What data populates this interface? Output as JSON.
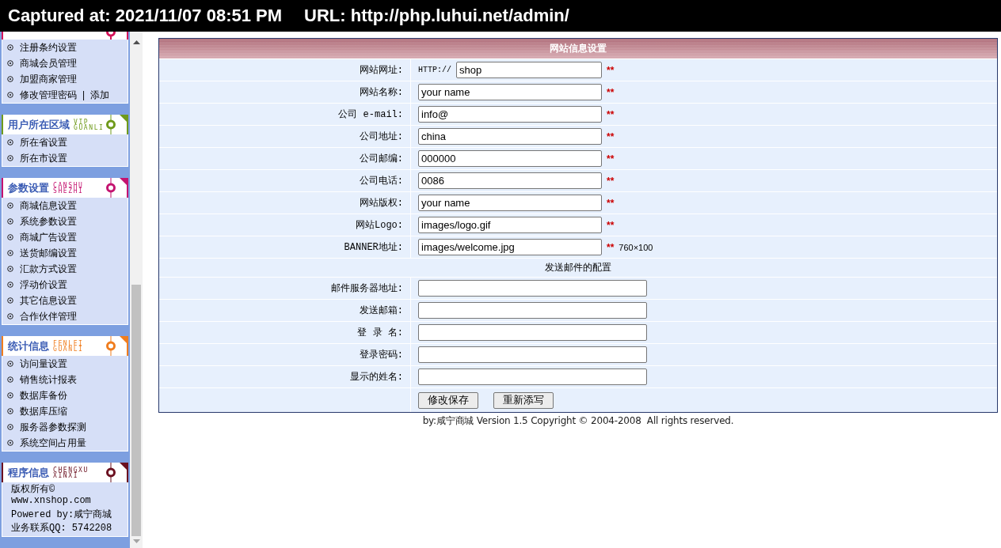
{
  "capture_banner": {
    "captured_at": "Captured at: 2021/11/07 08:51 PM",
    "url": "URL: http://php.luhui.net/admin/"
  },
  "sidebar": {
    "panels": [
      {
        "kind": "links",
        "color": "#d4145a",
        "items": [
          {
            "label": "注册条约设置"
          },
          {
            "label": "商城会员管理"
          },
          {
            "label": "加盟商家管理"
          },
          {
            "label": "修改管理密码",
            "separator": "|",
            "extra": "添加"
          }
        ]
      },
      {
        "kind": "links",
        "title": "用户所在区域",
        "subtitle": [
          "VIP",
          "GUANLI"
        ],
        "color": "#6f9a1b",
        "items": [
          {
            "label": "所在省设置"
          },
          {
            "label": "所在市设置"
          }
        ]
      },
      {
        "kind": "links",
        "title": "参数设置",
        "subtitle": [
          "CANSHU",
          "SHEZHI"
        ],
        "color": "#c41370",
        "items": [
          {
            "label": "商城信息设置"
          },
          {
            "label": "系统参数设置"
          },
          {
            "label": "商城广告设置"
          },
          {
            "label": "送货邮编设置"
          },
          {
            "label": "汇款方式设置"
          },
          {
            "label": "浮动价设置"
          },
          {
            "label": "其它信息设置"
          },
          {
            "label": "合作伙伴管理"
          }
        ]
      },
      {
        "kind": "links",
        "title": "统计信息",
        "subtitle": [
          "FENLEI",
          "GUANLI"
        ],
        "color": "#f07d1e",
        "items": [
          {
            "label": "访问量设置"
          },
          {
            "label": "销售统计报表"
          },
          {
            "label": "数据库备份"
          },
          {
            "label": "数据库压缩"
          },
          {
            "label": "服务器参数探测"
          },
          {
            "label": "系统空间占用量"
          }
        ]
      },
      {
        "kind": "info",
        "title": "程序信息",
        "subtitle": [
          "CHENGXU",
          "XINXI"
        ],
        "color": "#6b1020",
        "lines": [
          "版权所有©",
          "www.xnshop.com",
          "Powered by:咸宁商城",
          "业务联系QQ: 5742208"
        ]
      }
    ]
  },
  "form": {
    "title": "网站信息设置",
    "fields": [
      {
        "label": "网站网址:",
        "prefix": "HTTP://",
        "value": "shop",
        "mark": "**"
      },
      {
        "label": "网站名称:",
        "value": "your name",
        "mark": "**"
      },
      {
        "label": "公司 e-mail:",
        "value": "info@",
        "mark": "**"
      },
      {
        "label": "公司地址:",
        "value": "china",
        "mark": "**"
      },
      {
        "label": "公司邮编:",
        "value": "000000",
        "mark": "**"
      },
      {
        "label": "公司电话:",
        "value": "0086",
        "mark": "**"
      },
      {
        "label": "网站版权:",
        "value": "your name",
        "mark": "**"
      },
      {
        "label": "网站Logo:",
        "value": "images/logo.gif",
        "mark": "**"
      },
      {
        "label": "BANNER地址:",
        "value": "images/welcome.jpg",
        "mark": "**",
        "note": "760×100"
      }
    ],
    "section_title": "发送邮件的配置",
    "mail_fields": [
      {
        "label": "邮件服务器地址:"
      },
      {
        "label": "发送邮箱:"
      },
      {
        "label": "登 录 名:"
      },
      {
        "label": "登录密码:"
      },
      {
        "label": "显示的姓名:"
      }
    ],
    "buttons": [
      "修改保存",
      "重新添写"
    ]
  },
  "footer": "by:咸宁商城 Version 1.5 Copyright © 2004-2008  All rights reserved."
}
